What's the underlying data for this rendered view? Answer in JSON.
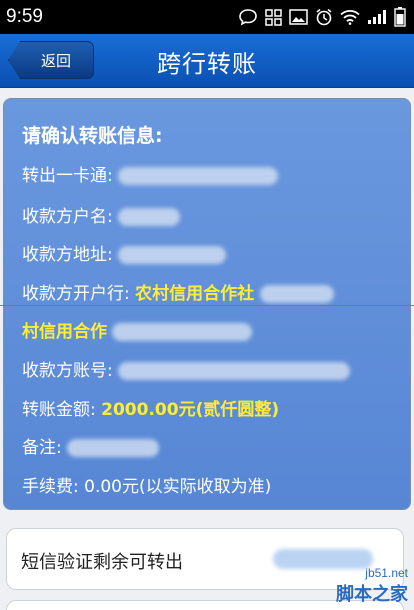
{
  "status_bar": {
    "time": "9:59",
    "icons": [
      "chat-icon",
      "grid-icon",
      "image-icon",
      "alarm-icon",
      "wifi-icon",
      "signal-icon",
      "battery-icon"
    ]
  },
  "header": {
    "back_label": "返回",
    "title": "跨行转账"
  },
  "confirm": {
    "heading": "请确认转账信息:",
    "card_label": "转出一卡通:",
    "payee_name_label": "收款方户名:",
    "payee_address_label": "收款方地址:",
    "payee_bank_label": "收款方开户行:",
    "payee_bank_value_line1": "农村信用合作社",
    "payee_bank_value_line2": "村信用合作",
    "payee_account_label": "收款方账号:",
    "amount_label": "转账金额:",
    "amount_value": "2000.00元(贰仟圆整)",
    "note_label": "备注:",
    "fee_label": "手续费:",
    "fee_value": "0.00元(以实际收取为准)"
  },
  "sms": {
    "label": "短信验证剩余可转出"
  },
  "watermark": {
    "site": "jb51.net",
    "name": "脚本之家"
  },
  "colors": {
    "header": "#0a4fb2",
    "card": "#5786d4",
    "highlight": "#ffee33"
  }
}
